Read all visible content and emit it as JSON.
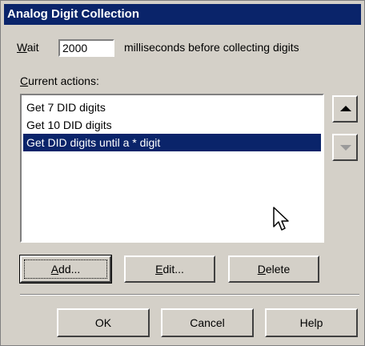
{
  "dialog": {
    "title": "Analog Digit Collection"
  },
  "wait": {
    "label_mnemonic": "W",
    "label_rest": "ait",
    "value": "2000",
    "suffix": "milliseconds before collecting digits"
  },
  "actions": {
    "label_mnemonic": "C",
    "label_rest": "urrent actions:",
    "items": [
      {
        "label": "Get 7 DID digits",
        "selected": false
      },
      {
        "label": "Get 10 DID digits",
        "selected": false
      },
      {
        "label": "Get DID digits until a * digit",
        "selected": true
      }
    ],
    "move_up_icon": "triangle-up-icon",
    "move_down_icon": "triangle-down-icon",
    "move_down_enabled": false
  },
  "buttons": {
    "add": {
      "mnemonic": "A",
      "rest": "dd..."
    },
    "edit": {
      "mnemonic": "E",
      "rest": "dit..."
    },
    "delete": {
      "mnemonic": "D",
      "rest": "elete"
    },
    "ok": "OK",
    "cancel": "Cancel",
    "help": "Help"
  },
  "colors": {
    "titlebar": "#0a246a",
    "selection": "#0a246a",
    "face": "#d4d0c8"
  }
}
